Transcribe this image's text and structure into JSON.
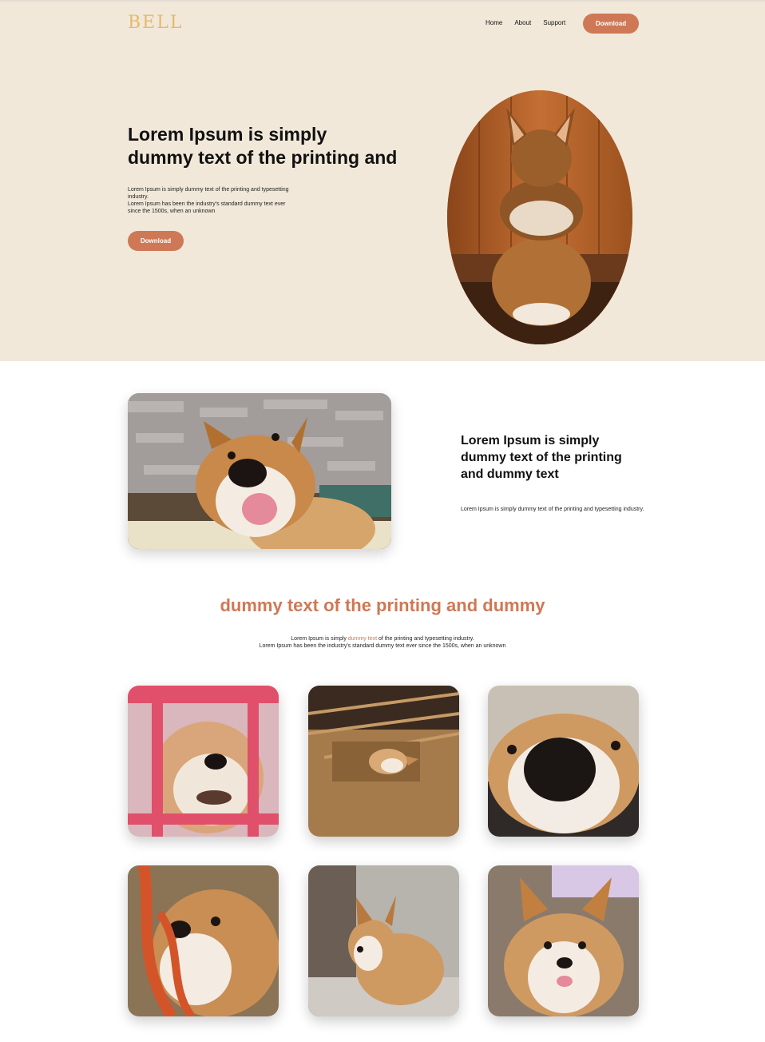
{
  "header": {
    "logo": "BELL",
    "nav": [
      "Home",
      "About",
      "Support"
    ],
    "download_label": "Download"
  },
  "hero": {
    "title_line1": "Lorem Ipsum is simply",
    "title_line2": "dummy text of the printing and",
    "text_line1": "Lorem Ipsum is simply dummy text of the printing and typesetting industry.",
    "text_line2": "Lorem Ipsum has been the industry's standard dummy text ever since the 1500s, when an unknown",
    "button_label": "Download"
  },
  "feature": {
    "title": "Lorem Ipsum is simply dummy text of the printing and dummy text",
    "text": "Lorem Ipsum is simply dummy text of the printing and typesetting industry."
  },
  "gallery": {
    "title": "dummy text of the printing and dummy",
    "text_before": "Lorem Ipsum is simply ",
    "text_accent": "dummy text",
    "text_after": " of the printing and typesetting industry.",
    "text_line2": "Lorem Ipsum has been the industry's standard dummy text ever since the 1500s, when an unknown"
  },
  "colors": {
    "accent": "#cf7855",
    "hero_bg": "#f1e8d9",
    "logo": "#e8b96a"
  }
}
